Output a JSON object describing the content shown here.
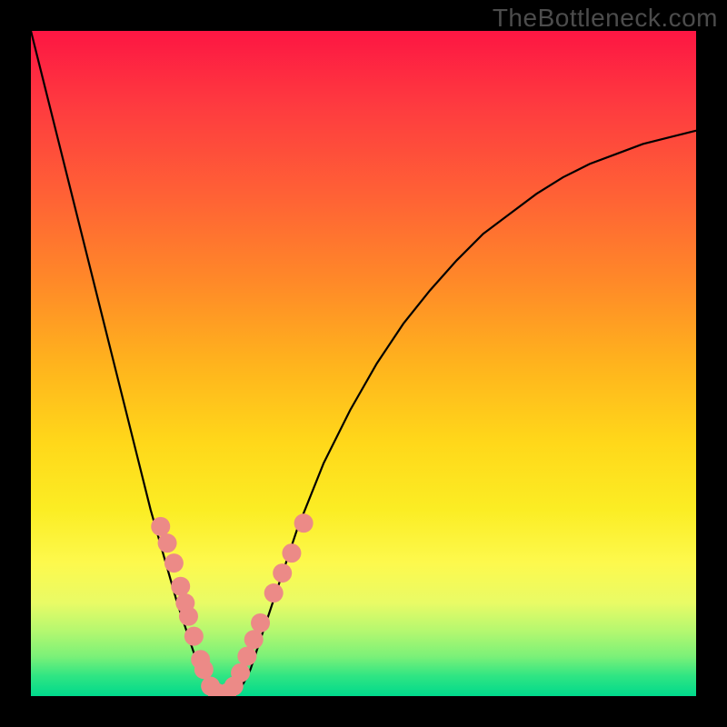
{
  "watermark": "TheBottleneck.com",
  "colors": {
    "frame_background": "#000000",
    "watermark_text": "#4c4c4c",
    "curve_stroke": "#000000",
    "marker_fill": "#ec8a87",
    "gradient_top": "#fd1643",
    "gradient_bottom": "#00d98c"
  },
  "chart_data": {
    "type": "line",
    "title": "",
    "xlabel": "",
    "ylabel": "",
    "x": [
      0.0,
      0.02,
      0.04,
      0.06,
      0.08,
      0.1,
      0.12,
      0.14,
      0.16,
      0.18,
      0.2,
      0.22,
      0.24,
      0.25,
      0.26,
      0.27,
      0.28,
      0.29,
      0.3,
      0.31,
      0.32,
      0.33,
      0.34,
      0.36,
      0.38,
      0.4,
      0.44,
      0.48,
      0.52,
      0.56,
      0.6,
      0.64,
      0.68,
      0.72,
      0.76,
      0.8,
      0.84,
      0.88,
      0.92,
      0.96,
      1.0
    ],
    "values": [
      1.0,
      0.92,
      0.84,
      0.76,
      0.68,
      0.6,
      0.52,
      0.44,
      0.36,
      0.28,
      0.21,
      0.14,
      0.08,
      0.05,
      0.03,
      0.015,
      0.005,
      0.0,
      0.0,
      0.005,
      0.02,
      0.04,
      0.07,
      0.13,
      0.19,
      0.25,
      0.35,
      0.43,
      0.5,
      0.56,
      0.61,
      0.655,
      0.695,
      0.725,
      0.755,
      0.78,
      0.8,
      0.815,
      0.83,
      0.84,
      0.85
    ],
    "xlim": [
      0,
      1
    ],
    "ylim": [
      0,
      1
    ],
    "markers_x": [
      0.195,
      0.205,
      0.215,
      0.225,
      0.232,
      0.237,
      0.245,
      0.255,
      0.26,
      0.27,
      0.28,
      0.29,
      0.295,
      0.305,
      0.315,
      0.325,
      0.335,
      0.345,
      0.365,
      0.378,
      0.392,
      0.41
    ],
    "markers_y": [
      0.255,
      0.23,
      0.2,
      0.165,
      0.14,
      0.12,
      0.09,
      0.055,
      0.04,
      0.015,
      0.005,
      0.0,
      0.005,
      0.015,
      0.035,
      0.06,
      0.085,
      0.11,
      0.155,
      0.185,
      0.215,
      0.26
    ]
  }
}
